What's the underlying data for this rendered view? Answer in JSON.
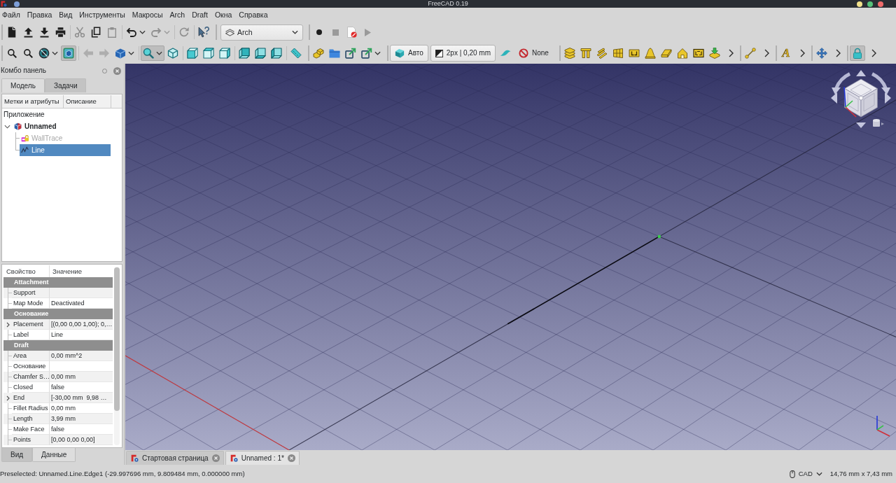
{
  "window": {
    "title": "FreeCAD 0.19"
  },
  "menu": [
    "Файл",
    "Правка",
    "Вид",
    "Инструменты",
    "Макросы",
    "Arch",
    "Draft",
    "Окна",
    "Справка"
  ],
  "toolbar_rows": [
    [
      {
        "overflow": false,
        "groups": [
          [
            {
              "kind": "icon",
              "disabled": false,
              "on": false
            },
            {
              "kind": "icon",
              "disabled": false,
              "on": false
            },
            {
              "kind": "icon",
              "disabled": false,
              "on": false
            },
            {
              "kind": "icon",
              "disabled": false,
              "on": false
            }
          ],
          [
            {
              "kind": "icon",
              "disabled": true,
              "on": false
            },
            {
              "kind": "icon",
              "disabled": false,
              "on": false
            },
            {
              "kind": "icon",
              "disabled": true,
              "on": false
            }
          ],
          [
            {
              "kind": "icon",
              "disabled": false,
              "on": false,
              "menu": true
            },
            {
              "kind": "icon",
              "disabled": true,
              "on": false,
              "menu": true
            }
          ],
          [
            {
              "kind": "icon",
              "disabled": true,
              "on": false
            }
          ],
          [
            {
              "kind": "icon",
              "disabled": false,
              "on": false
            }
          ]
        ]
      },
      {
        "overflow": false,
        "groups": [
          [
            {
              "kind": "combo",
              "value": "Arch",
              "disabled": false,
              "on": false
            }
          ]
        ]
      },
      {
        "overflow": false,
        "groups": [
          [
            {
              "kind": "icon",
              "disabled": false,
              "on": false
            },
            {
              "kind": "icon",
              "disabled": true,
              "on": false
            },
            {
              "kind": "icon",
              "disabled": false,
              "on": false
            },
            {
              "kind": "icon",
              "disabled": true,
              "on": false
            }
          ]
        ]
      }
    ],
    [
      {
        "overflow": false,
        "groups": [
          [
            {
              "kind": "icon",
              "disabled": false,
              "on": false
            },
            {
              "kind": "icon",
              "disabled": false,
              "on": false
            },
            {
              "kind": "icon",
              "disabled": false,
              "on": false,
              "menu": true
            },
            {
              "kind": "icon",
              "disabled": false,
              "on": true
            }
          ],
          [
            {
              "kind": "icon",
              "disabled": true,
              "on": false
            },
            {
              "kind": "icon",
              "disabled": true,
              "on": false
            },
            {
              "kind": "icon",
              "disabled": false,
              "on": false,
              "menu": true
            }
          ],
          [
            {
              "kind": "icon",
              "disabled": false,
              "on": true,
              "menu": true
            },
            {
              "kind": "icon",
              "disabled": false,
              "on": false
            }
          ],
          [
            {
              "kind": "icon",
              "disabled": false,
              "on": false
            },
            {
              "kind": "icon",
              "disabled": false,
              "on": false
            },
            {
              "kind": "icon",
              "disabled": false,
              "on": false
            }
          ],
          [
            {
              "kind": "icon",
              "disabled": false,
              "on": false
            },
            {
              "kind": "icon",
              "disabled": false,
              "on": false
            },
            {
              "kind": "icon",
              "disabled": false,
              "on": false
            }
          ],
          [
            {
              "kind": "icon",
              "disabled": false,
              "on": false
            }
          ]
        ]
      },
      {
        "overflow": false,
        "groups": [
          [
            {
              "kind": "icon",
              "disabled": false,
              "on": false
            },
            {
              "kind": "icon",
              "disabled": false,
              "on": false
            },
            {
              "kind": "icon",
              "disabled": false,
              "on": false
            },
            {
              "kind": "icon",
              "disabled": false,
              "on": false,
              "menu": true
            }
          ]
        ]
      },
      {
        "overflow": false,
        "groups": [
          [
            {
              "kind": "labeled",
              "label": "Авто",
              "raised": true,
              "disabled": false,
              "on": false
            },
            {
              "kind": "labeled",
              "label": "2px | 0,20 mm",
              "raised": true,
              "disabled": false,
              "on": false
            },
            {
              "kind": "icon",
              "disabled": false,
              "on": false
            },
            {
              "kind": "labeled",
              "label": "None",
              "raised": false,
              "disabled": false,
              "on": false
            }
          ]
        ]
      },
      {
        "overflow": true,
        "groups": [
          [
            {
              "kind": "icon",
              "disabled": false,
              "on": false
            },
            {
              "kind": "icon",
              "disabled": false,
              "on": false
            },
            {
              "kind": "icon",
              "disabled": false,
              "on": false
            },
            {
              "kind": "icon",
              "disabled": false,
              "on": false
            },
            {
              "kind": "icon",
              "disabled": false,
              "on": false
            },
            {
              "kind": "icon",
              "disabled": false,
              "on": false
            },
            {
              "kind": "icon",
              "disabled": false,
              "on": false
            },
            {
              "kind": "icon",
              "disabled": false,
              "on": false
            },
            {
              "kind": "icon",
              "disabled": false,
              "on": false
            },
            {
              "kind": "icon",
              "disabled": false,
              "on": false
            }
          ]
        ]
      },
      {
        "overflow": true,
        "groups": [
          [
            {
              "kind": "icon",
              "disabled": false,
              "on": false
            }
          ]
        ]
      },
      {
        "overflow": true,
        "groups": [
          [
            {
              "kind": "glyph",
              "glyph": "A",
              "disabled": false,
              "on": false
            }
          ]
        ]
      },
      {
        "overflow": true,
        "groups": [
          [
            {
              "kind": "icon",
              "disabled": false,
              "on": false
            }
          ]
        ]
      },
      {
        "overflow": true,
        "groups": [
          [
            {
              "kind": "icon",
              "disabled": false,
              "on": true
            }
          ]
        ]
      }
    ]
  ],
  "combo_panel": {
    "title": "Комбо панель",
    "tabs": [
      {
        "label": "Модель",
        "selected": true
      },
      {
        "label": "Задачи",
        "selected": false
      }
    ],
    "tree": {
      "columns": [
        "Метки и атрибуты",
        "Описание"
      ],
      "root": "Приложение",
      "items": [
        {
          "label": "Unnamed",
          "active": true,
          "expanded": true,
          "selected": false,
          "visible": true,
          "children": [
            {
              "label": "WallTrace",
              "selected": false,
              "visible": false
            },
            {
              "label": "Line",
              "selected": true,
              "visible": true
            }
          ]
        }
      ]
    },
    "properties": {
      "columns": [
        "Свойство",
        "Значение"
      ],
      "groups": [
        {
          "name": "Attachment",
          "rows": [
            {
              "name": "Support",
              "expandable": false
            },
            {
              "name": "Map Mode",
              "value": "Deactivated",
              "expandable": false
            }
          ]
        },
        {
          "name": "Основание",
          "rows": [
            {
              "name": "Placement",
              "value": "[(0,00 0,00 1,00); 0,…",
              "expandable": true
            },
            {
              "name": "Label",
              "value": "Line",
              "expandable": false
            }
          ]
        },
        {
          "name": "Draft",
          "rows": [
            {
              "name": "Area",
              "value": "0,00 mm^2",
              "expandable": false
            },
            {
              "name": "Основание",
              "expandable": false
            },
            {
              "name": "Chamfer S…",
              "value": "0,00 mm",
              "expandable": false
            },
            {
              "name": "Closed",
              "value": "false",
              "expandable": false
            },
            {
              "name": "End",
              "value": "[-30,00 mm  9,98 …",
              "expandable": true
            },
            {
              "name": "Fillet Radius",
              "value": "0,00 mm",
              "expandable": false
            },
            {
              "name": "Length",
              "value": "3,99 mm",
              "expandable": false
            },
            {
              "name": "Make Face",
              "value": "false",
              "expandable": false
            },
            {
              "name": "Points",
              "value": "[0,00 0,00 0,00]",
              "expandable": false
            }
          ]
        }
      ]
    },
    "property_tabs": [
      {
        "label": "Вид",
        "selected": false
      },
      {
        "label": "Данные",
        "selected": true
      }
    ]
  },
  "document_tabs": [
    {
      "label": "Стартовая страница",
      "selected": false
    },
    {
      "label": "Unnamed : 1*",
      "selected": true
    }
  ],
  "status_bar": {
    "message": "Preselected: Unnamed.Line.Edge1 (-29.997696 mm, 9.809484 mm, 0.000000 mm)",
    "navigation_style": "CAD",
    "dimensions": "14,76 mm x 7,43 mm"
  }
}
